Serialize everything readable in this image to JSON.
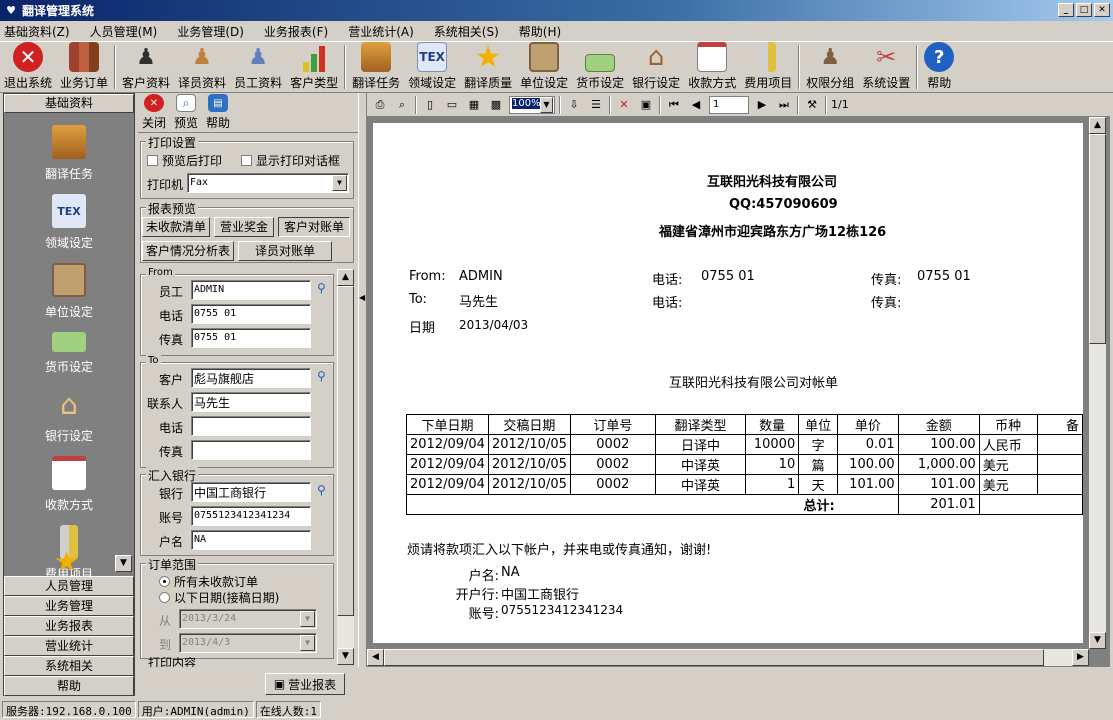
{
  "window": {
    "title": "翻译管理系统"
  },
  "menu": [
    "基础资料(Z)",
    "人员管理(M)",
    "业务管理(D)",
    "业务报表(F)",
    "营业统计(A)",
    "系统相关(S)",
    "帮助(H)"
  ],
  "toolbar": [
    {
      "label": "退出系统",
      "icon": "exit-icon",
      "color": "#d02020"
    },
    {
      "label": "业务订单",
      "icon": "books-icon",
      "color": "#a04030"
    },
    {
      "label": "客户资料",
      "icon": "person-suit-icon",
      "color": "#303030"
    },
    {
      "label": "译员资料",
      "icon": "person-icon",
      "color": "#c08040"
    },
    {
      "label": "员工资料",
      "icon": "staff-icon",
      "color": "#6080c0"
    },
    {
      "label": "客户类型",
      "icon": "bar-chart-icon",
      "color": "#40a040"
    },
    {
      "label": "翻译任务",
      "icon": "box-icon",
      "color": "#c08020"
    },
    {
      "label": "领域设定",
      "icon": "tex-icon",
      "color": "#204080"
    },
    {
      "label": "翻译质量",
      "icon": "star-icon",
      "color": "#f0b000"
    },
    {
      "label": "单位设定",
      "icon": "clipboard-icon",
      "color": "#4060a0"
    },
    {
      "label": "货币设定",
      "icon": "money-icon",
      "color": "#60a040"
    },
    {
      "label": "银行设定",
      "icon": "bank-icon",
      "color": "#a06030"
    },
    {
      "label": "收款方式",
      "icon": "calendar-icon",
      "color": "#a04040"
    },
    {
      "label": "费用项目",
      "icon": "ruler-icon",
      "color": "#a08040"
    },
    {
      "label": "权限分组",
      "icon": "lock-user-icon",
      "color": "#806040"
    },
    {
      "label": "系统设置",
      "icon": "tools-icon",
      "color": "#c04040"
    },
    {
      "label": "帮助",
      "icon": "help-icon",
      "color": "#2060c0"
    }
  ],
  "leftnav": {
    "header": "基础资料",
    "items": [
      {
        "label": "翻译任务",
        "icon": "box-icon"
      },
      {
        "label": "领域设定",
        "icon": "tex-icon"
      },
      {
        "label": "单位设定",
        "icon": "clipboard-icon"
      },
      {
        "label": "货币设定",
        "icon": "money-icon"
      },
      {
        "label": "银行设定",
        "icon": "bank-icon"
      },
      {
        "label": "收款方式",
        "icon": "calendar-icon"
      },
      {
        "label": "费用项目",
        "icon": "ruler-icon"
      }
    ],
    "footer": [
      "人员管理",
      "业务管理",
      "业务报表",
      "营业统计",
      "系统相关",
      "帮助"
    ]
  },
  "panel": {
    "toolbar": [
      "关闭",
      "预览",
      "帮助"
    ],
    "print_settings": {
      "title": "打印设置",
      "preview_after": "预览后打印",
      "show_dialog": "显示打印对话框",
      "printer_label": "打印机",
      "printer_value": "Fax"
    },
    "report_preview": {
      "title": "报表预览",
      "buttons": [
        "未收款清单",
        "营业奖金",
        "客户对账单",
        "客户情况分析表",
        "译员对账单"
      ]
    },
    "from": {
      "title": "From",
      "staff_label": "员工",
      "staff": "ADMIN",
      "phone_label": "电话",
      "phone": "0755 01",
      "fax_label": "传真",
      "fax": "0755 01"
    },
    "to": {
      "title": "To",
      "customer_label": "客户",
      "customer": "彪马旗舰店",
      "contact_label": "联系人",
      "contact": "马先生",
      "phone_label": "电话",
      "phone": "",
      "fax_label": "传真",
      "fax": ""
    },
    "bank": {
      "title": "汇入银行",
      "bank_label": "银行",
      "bank": "中国工商银行",
      "account_label": "账号",
      "account": "0755123412341234",
      "name_label": "户名",
      "name": "NA"
    },
    "range": {
      "title": "订单范围",
      "opt1": "所有未收款订单",
      "opt2": "以下日期(接稿日期)",
      "from_label": "从",
      "from": "2013/3/24",
      "to_label": "到",
      "to": "2013/4/3"
    },
    "cut_title": "打印内容"
  },
  "viewer": {
    "zoom": "100%",
    "page": "1",
    "pages": "1/1"
  },
  "report": {
    "company": "互联阳光科技有限公司",
    "qq": "QQ:457090609",
    "address": "福建省漳州市迎宾路东方广场12栋126",
    "from_label": "From:",
    "from": "ADMIN",
    "to_label": "To:",
    "to": "马先生",
    "date_label": "日期",
    "date": "2013/04/03",
    "phone_label": "电话:",
    "phone": "0755 01",
    "phone2": "",
    "fax_label": "传真:",
    "fax": "0755 01",
    "fax2": "",
    "statement_title": "互联阳光科技有限公司对帐单",
    "columns": [
      "下单日期",
      "交稿日期",
      "订单号",
      "翻译类型",
      "数量",
      "单位",
      "单价",
      "金额",
      "币种",
      "备"
    ],
    "rows": [
      [
        "2012/09/04",
        "2012/10/05",
        "0002",
        "日译中",
        "10000",
        "字",
        "0.01",
        "100.00",
        "人民币",
        ""
      ],
      [
        "2012/09/04",
        "2012/10/05",
        "0002",
        "中译英",
        "10",
        "篇",
        "100.00",
        "1,000.00",
        "美元",
        ""
      ],
      [
        "2012/09/04",
        "2012/10/05",
        "0002",
        "中译英",
        "1",
        "天",
        "101.00",
        "101.00",
        "美元",
        ""
      ]
    ],
    "total_label": "总计:",
    "total": "201.01",
    "notice": "烦请将款项汇入以下帐户，并来电或传真通知，谢谢!",
    "acct_name_label": "户名:",
    "acct_name": "NA",
    "acct_bank_label": "开户行:",
    "acct_bank": "中国工商银行",
    "acct_no_label": "账号:",
    "acct_no": "0755123412341234"
  },
  "task": {
    "label": "营业报表"
  },
  "status": {
    "server": "服务器:192.168.0.100",
    "user": "用户:ADMIN(admin)",
    "online": "在线人数:1"
  }
}
